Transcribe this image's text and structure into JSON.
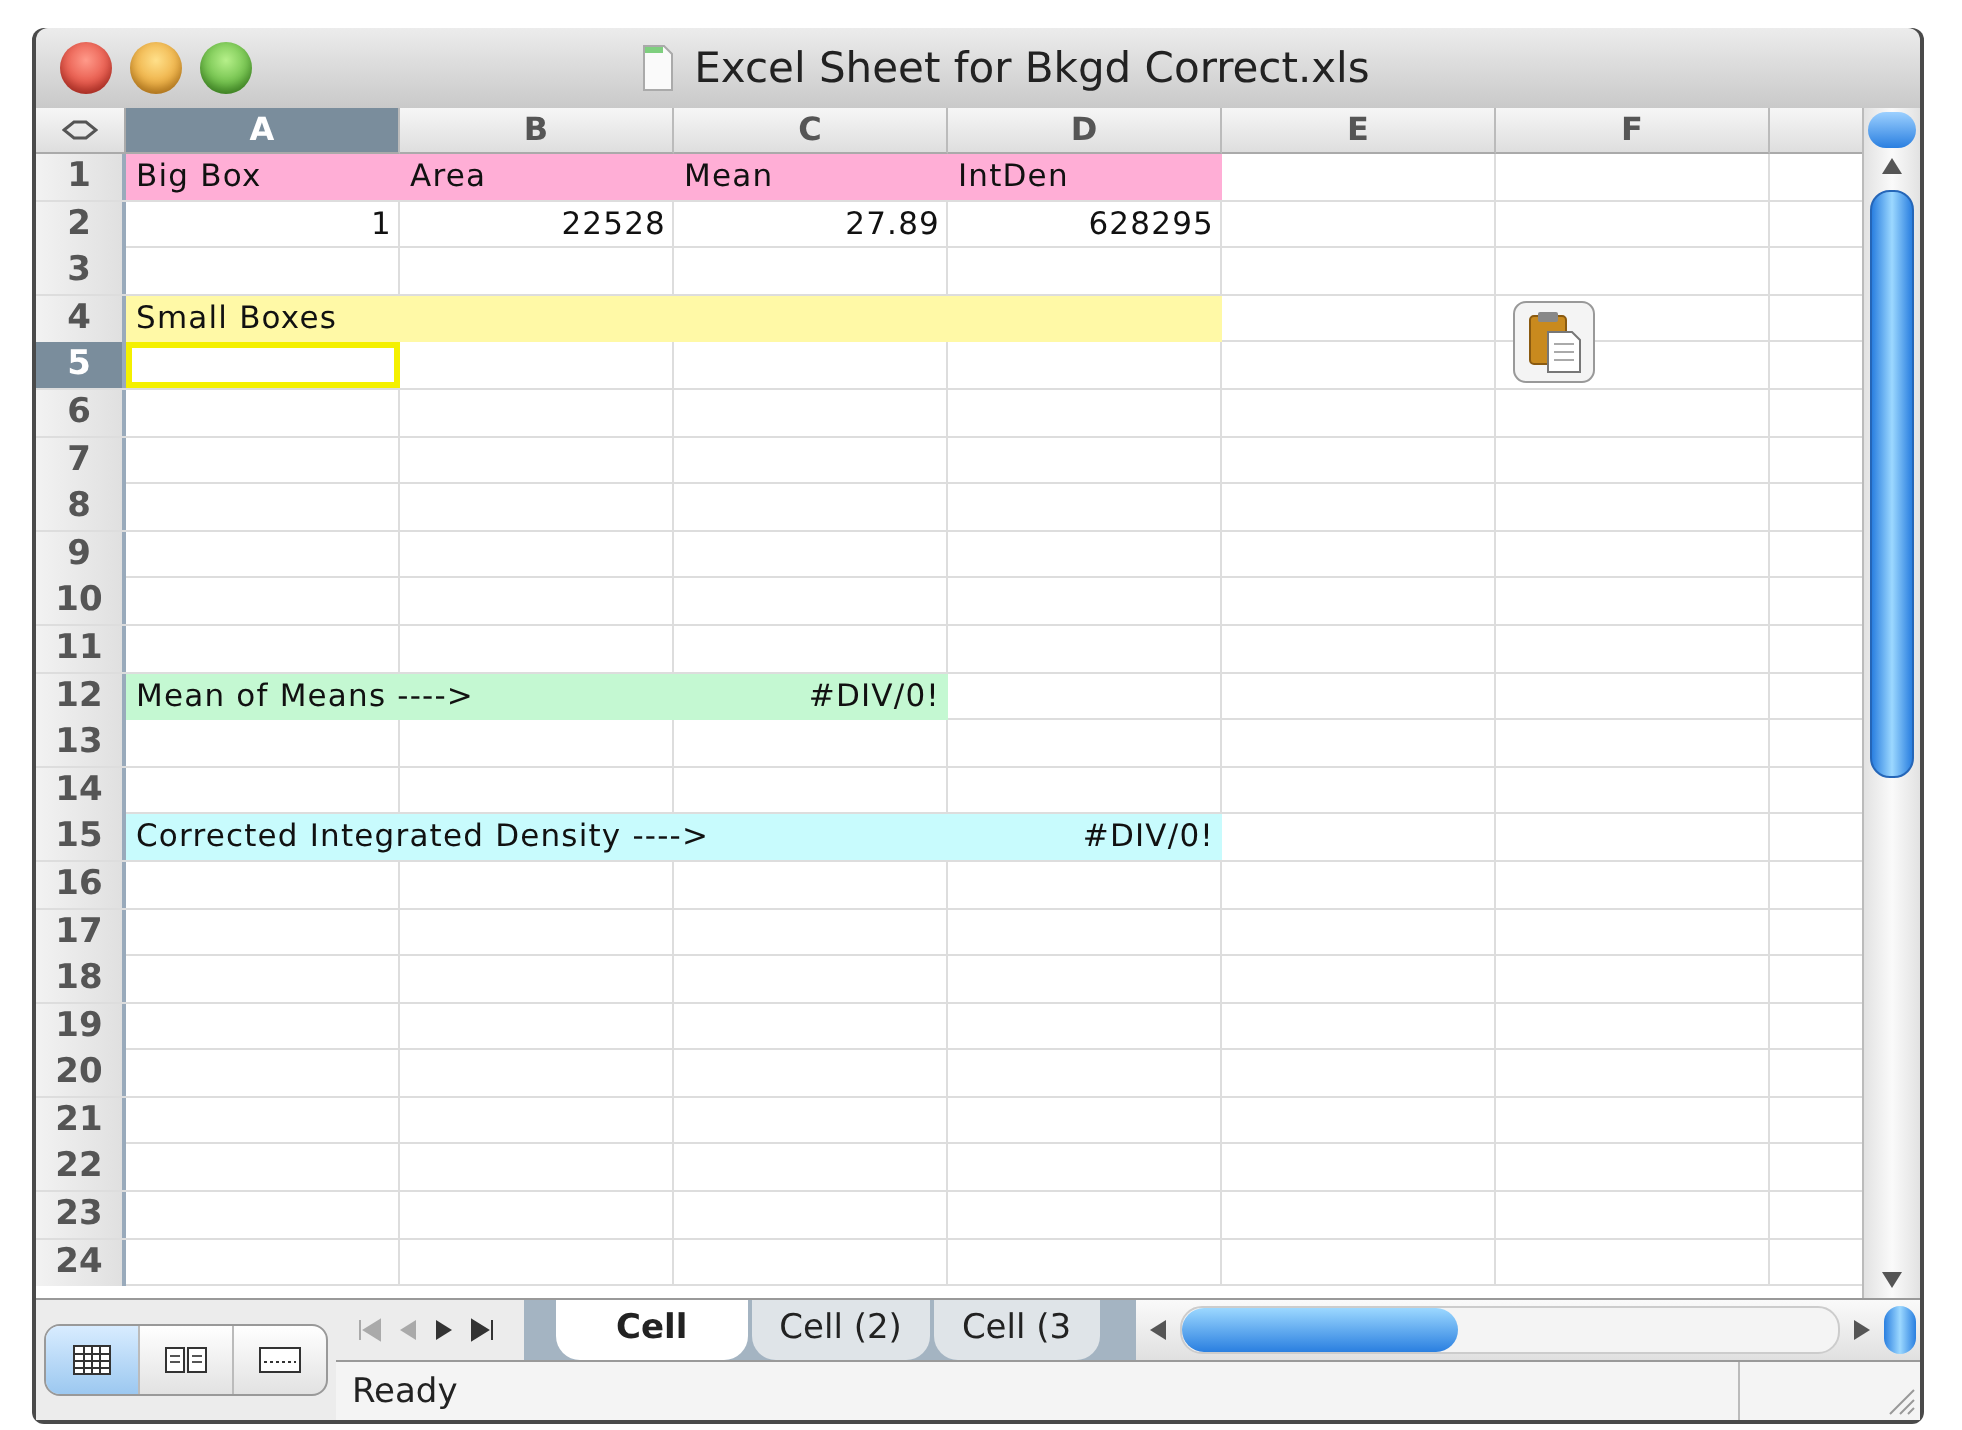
{
  "window": {
    "title": "Excel Sheet for Bkgd Correct.xls"
  },
  "columns": [
    {
      "label": "A",
      "selected": true
    },
    {
      "label": "B",
      "selected": false
    },
    {
      "label": "C",
      "selected": false
    },
    {
      "label": "D",
      "selected": false
    },
    {
      "label": "E",
      "selected": false
    },
    {
      "label": "F",
      "selected": false
    }
  ],
  "rows": [
    {
      "number": "1",
      "selected": false,
      "cells": [
        {
          "kind": "text",
          "text": "Big Box",
          "color": "#ffaed6"
        },
        {
          "kind": "text",
          "text": "Area",
          "color": "#ffaed6"
        },
        {
          "kind": "text",
          "text": "Mean",
          "color": "#ffaed6"
        },
        {
          "kind": "text",
          "text": "IntDen",
          "color": "#ffaed6"
        }
      ]
    },
    {
      "number": "2",
      "selected": false,
      "cells": [
        {
          "kind": "number",
          "text": "1"
        },
        {
          "kind": "number",
          "text": "22528"
        },
        {
          "kind": "number",
          "text": "27.89"
        },
        {
          "kind": "number",
          "text": "628295"
        }
      ]
    },
    {
      "number": "3",
      "selected": false
    },
    {
      "number": "4",
      "selected": false,
      "cells": [
        {
          "kind": "text",
          "text": "Small Boxes",
          "color": "#fff9a6"
        },
        {
          "color": "#fff9a6"
        },
        {
          "color": "#fff9a6"
        },
        {
          "color": "#fff9a6"
        }
      ]
    },
    {
      "number": "5",
      "selected": true,
      "cells": [
        {
          "active": true
        }
      ]
    },
    {
      "number": "6",
      "selected": false
    },
    {
      "number": "7",
      "selected": false
    },
    {
      "number": "8",
      "selected": false
    },
    {
      "number": "9",
      "selected": false
    },
    {
      "number": "10",
      "selected": false
    },
    {
      "number": "11",
      "selected": false
    },
    {
      "number": "12",
      "selected": false,
      "cells": [
        {
          "kind": "text",
          "text": "Mean of Means ---->",
          "color": "#c4f8d2"
        },
        {
          "color": "#c4f8d2"
        },
        {
          "kind": "number",
          "text": "#DIV/0!",
          "color": "#c4f8d2"
        }
      ]
    },
    {
      "number": "13",
      "selected": false
    },
    {
      "number": "14",
      "selected": false
    },
    {
      "number": "15",
      "selected": false,
      "cells": [
        {
          "kind": "text",
          "text": "Corrected Integrated Density ---->",
          "color": "#c8fbfd"
        },
        {
          "color": "#c8fbfd"
        },
        {
          "color": "#c8fbfd"
        },
        {
          "kind": "number",
          "text": "#DIV/0!",
          "color": "#c8fbfd"
        }
      ]
    },
    {
      "number": "16",
      "selected": false
    },
    {
      "number": "17",
      "selected": false
    },
    {
      "number": "18",
      "selected": false
    },
    {
      "number": "19",
      "selected": false
    },
    {
      "number": "20",
      "selected": false
    },
    {
      "number": "21",
      "selected": false
    },
    {
      "number": "22",
      "selected": false
    },
    {
      "number": "23",
      "selected": false
    },
    {
      "number": "24",
      "selected": false
    }
  ],
  "sheet_tabs": [
    {
      "label": "Cell",
      "selected": true
    },
    {
      "label": "Cell (2)",
      "selected": false
    },
    {
      "label": "Cell (3",
      "selected": false
    }
  ],
  "status_bar": {
    "text": "Ready"
  }
}
